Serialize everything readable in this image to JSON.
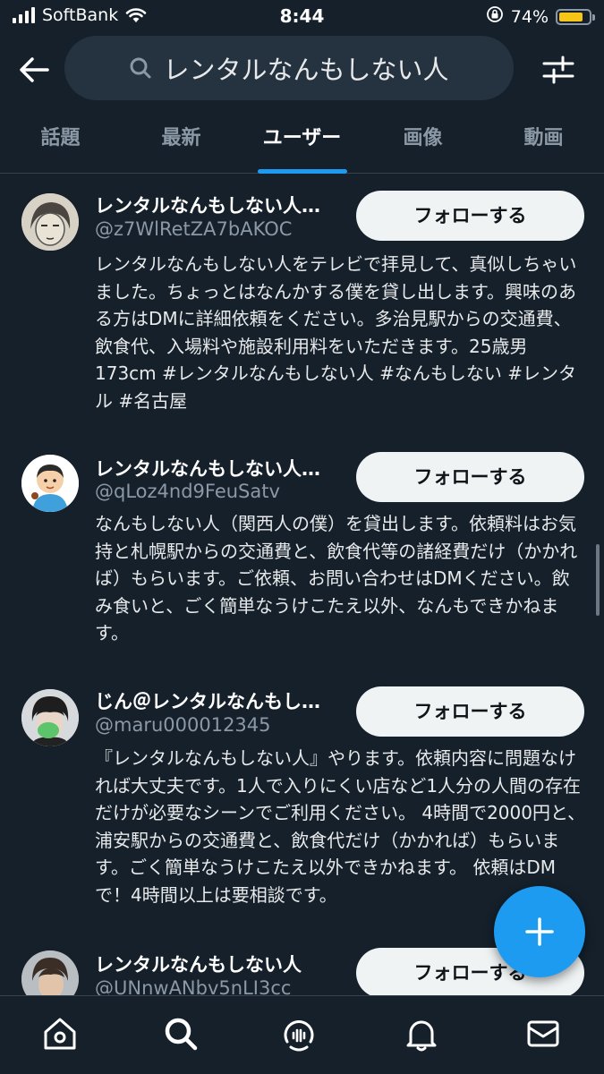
{
  "status_bar": {
    "carrier": "SoftBank",
    "time": "8:44",
    "battery_percent": "74%",
    "battery_level": 0.74
  },
  "header": {
    "back_icon": "arrow-left-icon",
    "search_query": "レンタルなんもしない人",
    "filter_icon": "sliders-icon"
  },
  "tabs": [
    {
      "label": "話題",
      "active": false
    },
    {
      "label": "最新",
      "active": false
    },
    {
      "label": "ユーザー",
      "active": true
    },
    {
      "label": "画像",
      "active": false
    },
    {
      "label": "動画",
      "active": false
    }
  ],
  "users": [
    {
      "name": "レンタルなんもしない人…",
      "handle": "@z7WlRetZA7bAKOC",
      "follow_label": "フォローする",
      "bio": "レンタルなんもしない人をテレビで拝見して、真似しちゃいました。ちょっとはなんかする僕を貸し出します。興味のある方はDMに詳細依頼をください。多治見駅からの交通費、飲食代、入場料や施設利用料をいただきます。25歳男173cm #レンタルなんもしない人 #なんもしない #レンタル #名古屋"
    },
    {
      "name": "レンタルなんもしない人…",
      "handle": "@qLoz4nd9FeuSatv",
      "follow_label": "フォローする",
      "bio": "なんもしない人（関西人の僕）を貸出します。依頼料はお気持と札幌駅からの交通費と、飲食代等の諸経費だけ（かかれば）もらいます。ご依頼、お問い合わせはDMください。飲み食いと、ごく簡単なうけこたえ以外、なんもできかねます。"
    },
    {
      "name": "じん＠レンタルなんもし…",
      "handle": "@maru000012345",
      "follow_label": "フォローする",
      "bio": "『レンタルなんもしない人』やります。依頼内容に問題なければ大丈夫です。1人で入りにくい店など1人分の人間の存在だけが必要なシーンでご利用ください。 4時間で2000円と、浦安駅からの交通費と、飲食代だけ（かかれば）もらいます。ごく簡単なうけこたえ以外できかねます。 依頼はDMで！4時間以上は要相談です。"
    },
    {
      "name": "レンタルなんもしない人",
      "handle": "@UNnwANbv5nLI3cc",
      "follow_label": "フォローする",
      "bio": ""
    }
  ],
  "fab": {
    "icon": "plus-icon"
  },
  "bottom_nav": [
    {
      "icon": "home-icon"
    },
    {
      "icon": "search-icon",
      "active": true
    },
    {
      "icon": "spaces-icon"
    },
    {
      "icon": "bell-icon"
    },
    {
      "icon": "mail-icon"
    }
  ],
  "colors": {
    "background": "#15202b",
    "accent": "#1d9bf0",
    "secondary_text": "#8b98a5",
    "button_bg": "#eff3f4"
  }
}
